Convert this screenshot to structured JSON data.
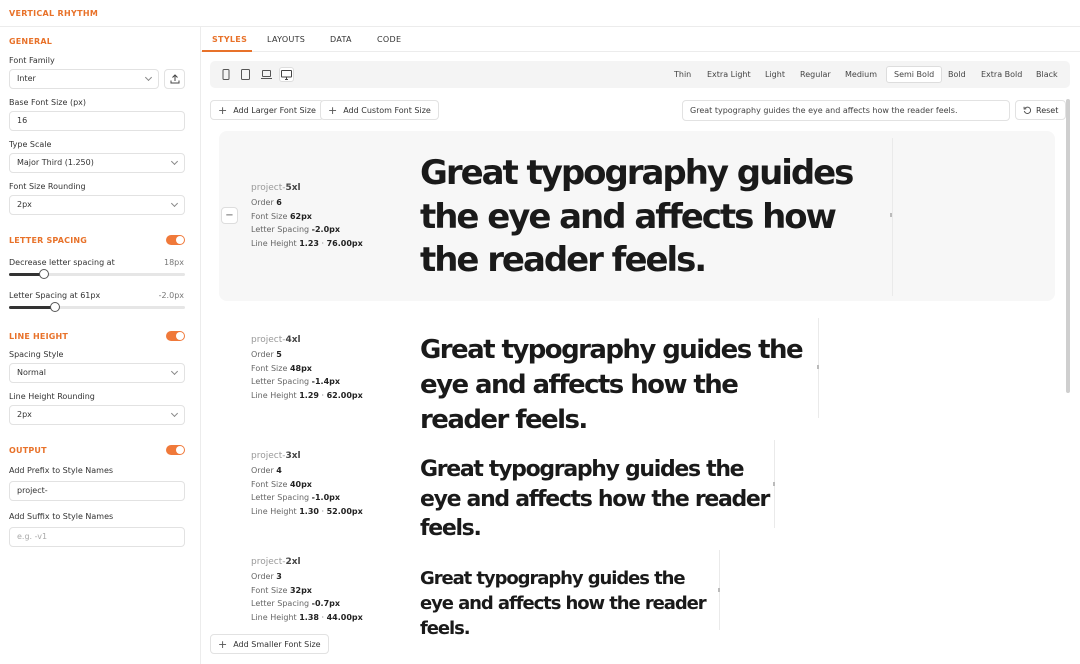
{
  "app": {
    "title": "VERTICAL RHYTHM"
  },
  "sidebar": {
    "general": {
      "title": "GENERAL",
      "font_family_label": "Font Family",
      "font_family_value": "Inter",
      "base_size_label": "Base Font Size (px)",
      "base_size_value": "16",
      "type_scale_label": "Type Scale",
      "type_scale_value": "Major Third (1.250)",
      "rounding_label": "Font Size Rounding",
      "rounding_value": "2px"
    },
    "letter_spacing": {
      "title": "LETTER SPACING",
      "enabled": true,
      "decrease_label": "Decrease letter spacing at",
      "decrease_value": "18px",
      "decrease_fraction": 0.2,
      "spacing_label": "Letter Spacing at 61px",
      "spacing_value": "-2.0px",
      "spacing_fraction": 0.26
    },
    "line_height": {
      "title": "LINE HEIGHT",
      "enabled": true,
      "spacing_style_label": "Spacing Style",
      "spacing_style_value": "Normal",
      "rounding_label": "Line Height Rounding",
      "rounding_value": "2px"
    },
    "output": {
      "title": "OUTPUT",
      "enabled": true,
      "prefix_label": "Add Prefix to Style Names",
      "prefix_value": "project-",
      "suffix_label": "Add Suffix to Style Names",
      "suffix_placeholder": "e.g. -v1"
    }
  },
  "tabs": [
    {
      "label": "STYLES",
      "active": true
    },
    {
      "label": "LAYOUTS"
    },
    {
      "label": "DATA"
    },
    {
      "label": "CODE"
    }
  ],
  "toolbar": {
    "devices": [
      "mobile-icon",
      "tablet-icon",
      "laptop-icon",
      "desktop-icon"
    ],
    "active_device": "desktop-icon",
    "weights": [
      "Thin",
      "Extra Light",
      "Light",
      "Regular",
      "Medium",
      "Semi Bold",
      "Bold",
      "Extra Bold",
      "Black"
    ],
    "active_weight": "Semi Bold"
  },
  "actions": {
    "add_larger": "Add Larger Font Size",
    "add_custom": "Add Custom Font Size",
    "add_smaller": "Add Smaller Font Size",
    "reset": "Reset"
  },
  "sample_text": "Great typography guides the eye and affects how the reader feels.",
  "styles": [
    {
      "prefix": "project-",
      "name": "5xl",
      "order_label": "Order",
      "order": "6",
      "font_size_label": "Font Size",
      "font_size": "62px",
      "ls_label": "Letter Spacing",
      "ls": "-2.0px",
      "lh_label": "Line Height",
      "lh": "1.23",
      "lh_px": "76.00px"
    },
    {
      "prefix": "project-",
      "name": "4xl",
      "order_label": "Order",
      "order": "5",
      "font_size_label": "Font Size",
      "font_size": "48px",
      "ls_label": "Letter Spacing",
      "ls": "-1.4px",
      "lh_label": "Line Height",
      "lh": "1.29",
      "lh_px": "62.00px"
    },
    {
      "prefix": "project-",
      "name": "3xl",
      "order_label": "Order",
      "order": "4",
      "font_size_label": "Font Size",
      "font_size": "40px",
      "ls_label": "Letter Spacing",
      "ls": "-1.0px",
      "lh_label": "Line Height",
      "lh": "1.30",
      "lh_px": "52.00px"
    },
    {
      "prefix": "project-",
      "name": "2xl",
      "order_label": "Order",
      "order": "3",
      "font_size_label": "Font Size",
      "font_size": "32px",
      "ls_label": "Letter Spacing",
      "ls": "-0.7px",
      "lh_label": "Line Height",
      "lh": "1.38",
      "lh_px": "44.00px"
    }
  ]
}
